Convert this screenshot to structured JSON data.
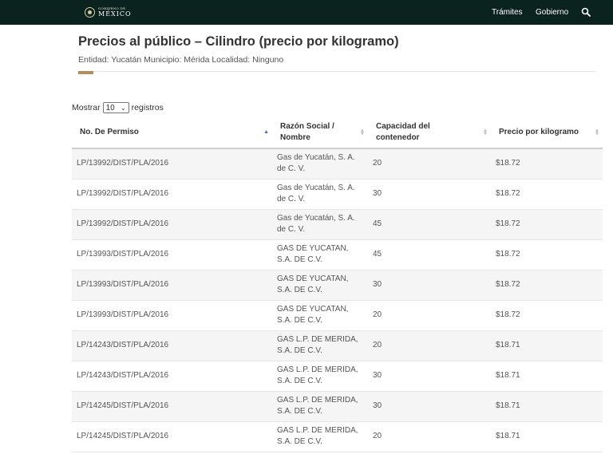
{
  "header": {
    "logo_small": "GOBIERNO DE",
    "logo_big": "MÉXICO",
    "nav": [
      "Trámites",
      "Gobierno"
    ],
    "search_icon": "search-icon"
  },
  "page": {
    "title": "Precios al público – Cilindro (precio por kilogramo)",
    "subtitle": "Entidad: Yucatán Municipio: Mérida Localidad: Ninguno"
  },
  "length_control": {
    "prefix": "Mostrar",
    "value": "10",
    "suffix": "registros"
  },
  "table": {
    "columns": [
      "No. De Permiso",
      "Razón Social / Nombre",
      "Capacidad del contenedor",
      "Precio por kilogramo"
    ],
    "rows": [
      [
        "LP/13992/DIST/PLA/2016",
        "Gas de Yucatán, S. A. de C. V.",
        "20",
        "$18.72"
      ],
      [
        "LP/13992/DIST/PLA/2016",
        "Gas de Yucatán, S. A. de C. V.",
        "30",
        "$18.72"
      ],
      [
        "LP/13992/DIST/PLA/2016",
        "Gas de Yucatán, S. A. de C. V.",
        "45",
        "$18.72"
      ],
      [
        "LP/13993/DIST/PLA/2016",
        "GAS DE YUCATAN, S.A. DE C.V.",
        "45",
        "$18.72"
      ],
      [
        "LP/13993/DIST/PLA/2016",
        "GAS DE YUCATAN, S.A. DE C.V.",
        "30",
        "$18.72"
      ],
      [
        "LP/13993/DIST/PLA/2016",
        "GAS DE YUCATAN, S.A. DE C.V.",
        "20",
        "$18.72"
      ],
      [
        "LP/14243/DIST/PLA/2016",
        "GAS L.P. DE MERIDA, S.A. DE C.V.",
        "20",
        "$18.71"
      ],
      [
        "LP/14243/DIST/PLA/2016",
        "GAS L.P. DE MERIDA, S.A. DE C.V.",
        "30",
        "$18.71"
      ],
      [
        "LP/14245/DIST/PLA/2016",
        "GAS L.P. DE MERIDA, S.A. DE C.V.",
        "30",
        "$18.71"
      ],
      [
        "LP/14245/DIST/PLA/2016",
        "GAS L.P. DE MERIDA, S.A. DE C.V.",
        "20",
        "$18.71"
      ]
    ]
  },
  "colors": {
    "topbar": "#0b231e",
    "accent": "#b38e5d",
    "sort_active": "#4a6fa5"
  }
}
